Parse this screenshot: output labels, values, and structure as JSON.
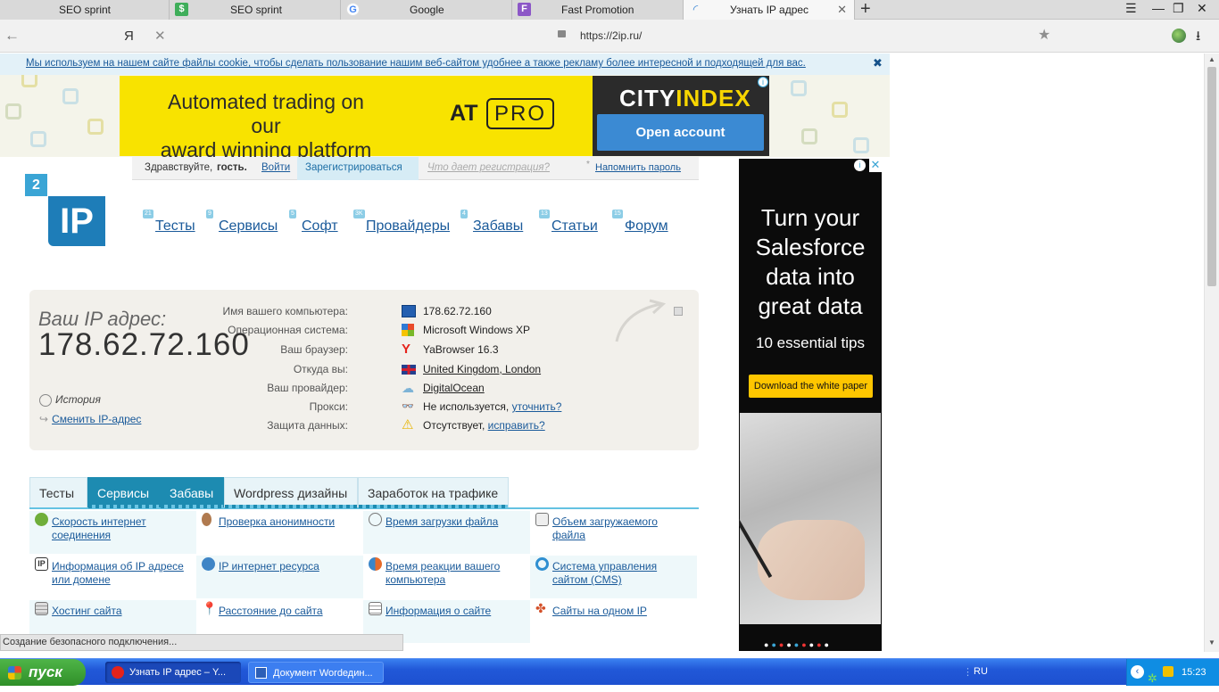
{
  "browser": {
    "tabs": [
      {
        "title": "SEO sprint"
      },
      {
        "title": "SEO sprint"
      },
      {
        "title": "Google"
      },
      {
        "title": "Fast Promotion"
      },
      {
        "title": "Узнать IP адрес"
      }
    ],
    "url": "https://2ip.ru/",
    "yandex_letter": "Я"
  },
  "page": {
    "cookie_notice": "Мы используем на нашем сайте файлы cookie, чтобы сделать пользование нашим веб-сайтом удобнее а также рекламу более интересной и подходящей для вас.",
    "banner": {
      "line1": "Automated trading on our",
      "line2": "award winning platform",
      "at": "AT",
      "pro": "PRO",
      "brand_a": "CITY",
      "brand_b": "INDEX",
      "cta": "Open account"
    },
    "login": {
      "greet": "Здравствуйте,",
      "guest": "гость.",
      "login": "Войти",
      "register": "Зарегистрироваться",
      "why": "Что дает регистрация?",
      "remind": "Напомнить пароль"
    },
    "logo": {
      "top": "2",
      "main": "IP"
    },
    "nav": [
      {
        "label": "Тесты",
        "count": "21"
      },
      {
        "label": "Сервисы",
        "count": "9"
      },
      {
        "label": "Софт",
        "count": "5"
      },
      {
        "label": "Провайдеры",
        "count": "3K"
      },
      {
        "label": "Забавы",
        "count": "4"
      },
      {
        "label": "Статьи",
        "count": "13"
      },
      {
        "label": "Форум",
        "count": "15"
      }
    ],
    "ip": {
      "label": "Ваш IP адрес:",
      "value": "178.62.72.160",
      "history": "История",
      "change": "Сменить IP-адрес",
      "rows": [
        {
          "k": "Имя вашего компьютера:",
          "v": "178.62.72.160"
        },
        {
          "k": "Операционная система:",
          "v": "Microsoft Windows XP"
        },
        {
          "k": "Ваш браузер:",
          "v": "YaBrowser 16.3"
        },
        {
          "k": "Откуда вы:",
          "v": "United Kingdom, London"
        },
        {
          "k": "Ваш провайдер:",
          "v": "DigitalOcean"
        },
        {
          "k": "Прокси:",
          "v": "Не используется,",
          "link": "уточнить?"
        },
        {
          "k": "Защита данных:",
          "v": "Отсутствует,",
          "link": "исправить?"
        }
      ]
    },
    "section_tabs": [
      "Тесты",
      "Сервисы",
      "Забавы",
      "Wordpress дизайны",
      "Заработок на трафике"
    ],
    "services": [
      [
        "Скорость интернет",
        "соединения"
      ],
      [
        "Проверка анонимности",
        ""
      ],
      [
        "Время загрузки файла",
        ""
      ],
      [
        "Объем загружаемого",
        "файла"
      ],
      [
        "Информация об IP адресе",
        "или домене"
      ],
      [
        "IP интернет ресурса",
        ""
      ],
      [
        "Время реакции вашего",
        "компьютера"
      ],
      [
        "Система управления",
        "сайтом (CMS)"
      ],
      [
        "Хостинг сайта",
        ""
      ],
      [
        "Расстояние до сайта",
        ""
      ],
      [
        "Информация о сайте",
        ""
      ],
      [
        "Сайты на одном IP",
        ""
      ]
    ],
    "side_ad": {
      "headline": [
        "Turn your",
        "Salesforce",
        "data into",
        "great data"
      ],
      "tips": "10 essential tips",
      "cta": "Download the white paper"
    }
  },
  "status_text": "Создание безопасного подключения...",
  "taskbar": {
    "start": "пуск",
    "items": [
      "Узнать IP адрес – Y...",
      "Документ Wordедин..."
    ],
    "lang": "RU",
    "clock": "15:23"
  },
  "colors": {
    "accent": "#1d8bb1",
    "link": "#1a5a9a",
    "banner": "#f8e300"
  }
}
